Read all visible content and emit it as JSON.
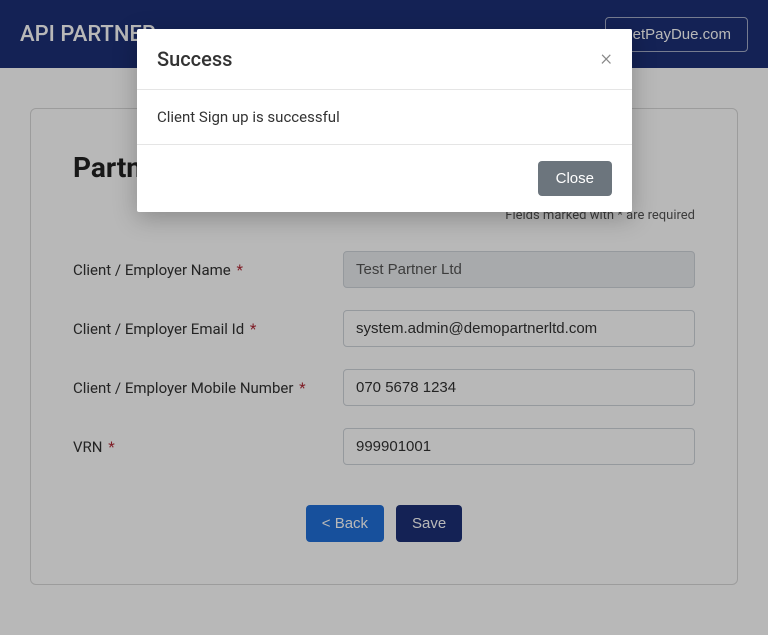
{
  "header": {
    "title": "API PARTNER",
    "link_label": "NetPayDue.com"
  },
  "card": {
    "title": "Partner",
    "required_note": "Fields marked with * are required"
  },
  "form": {
    "client_name": {
      "label": "Client / Employer Name",
      "value": "Test Partner Ltd"
    },
    "client_email": {
      "label": "Client / Employer Email Id",
      "value": "system.admin@demopartnerltd.com"
    },
    "client_mobile": {
      "label": "Client / Employer Mobile Number",
      "value": "070 5678 1234"
    },
    "vrn": {
      "label": "VRN",
      "value": "999901001"
    }
  },
  "buttons": {
    "back": "< Back",
    "save": "Save"
  },
  "modal": {
    "title": "Success",
    "message": "Client Sign up is successful",
    "close_label": "Close"
  }
}
